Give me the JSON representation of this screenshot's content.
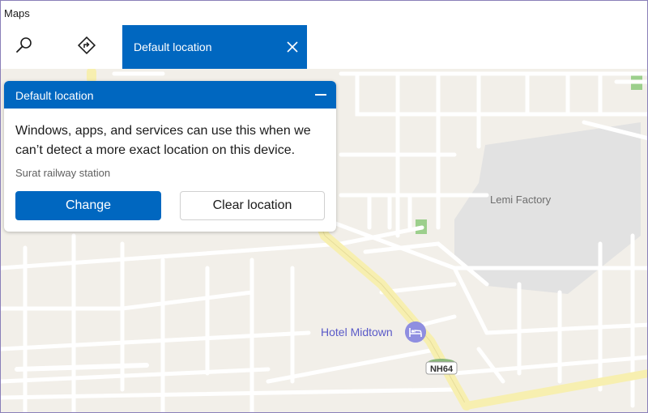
{
  "app": {
    "title": "Maps"
  },
  "toolbar": {
    "search_icon": "search-icon",
    "directions_icon": "directions-icon"
  },
  "search_chip": {
    "label": "Default location",
    "close_icon": "close-icon"
  },
  "panel": {
    "title": "Default location",
    "minimize_icon": "minimize-icon",
    "description": "Windows, apps, and services can use this when we can’t detect a more exact location on this device.",
    "current_location": "Surat railway station",
    "change_label": "Change",
    "clear_label": "Clear location"
  },
  "map": {
    "factory_label": "Lemi Factory",
    "poi_label": "Hotel Midtown",
    "poi_icon": "bed-icon",
    "road_shield": "NH64"
  },
  "colors": {
    "accent": "#0067c0",
    "map_background": "#f2efe9",
    "road": "#ffffff",
    "highway": "#f7efb0",
    "industrial": "#e2e2e2",
    "park": "#9ccf8c",
    "poi": "#8f8ee0"
  }
}
